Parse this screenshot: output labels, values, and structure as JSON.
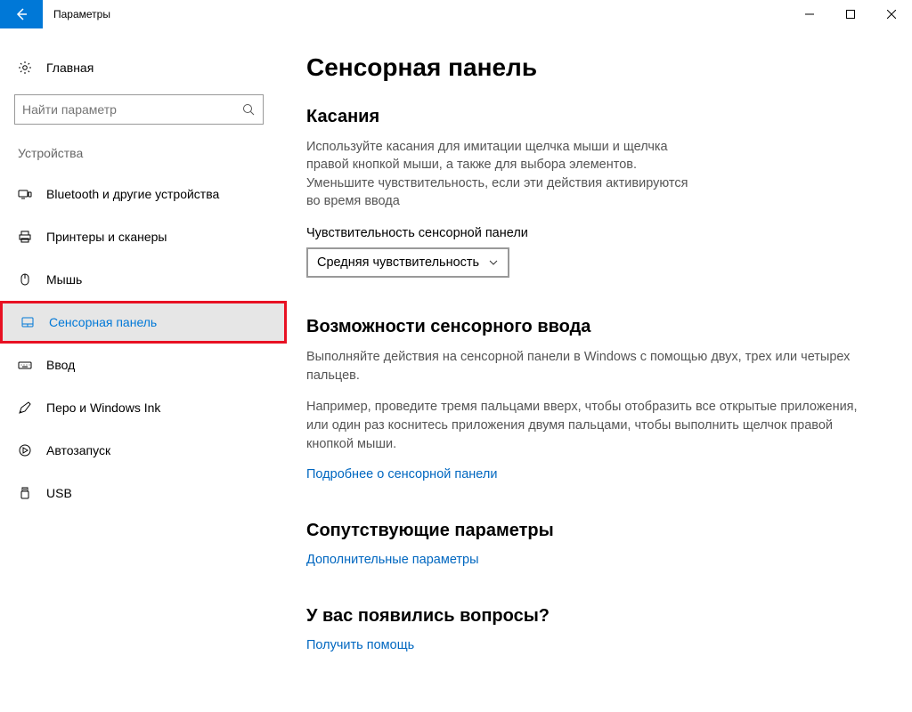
{
  "window": {
    "title": "Параметры"
  },
  "sidebar": {
    "home": "Главная",
    "search_placeholder": "Найти параметр",
    "category": "Устройства",
    "items": [
      {
        "label": "Bluetooth и другие устройства"
      },
      {
        "label": "Принтеры и сканеры"
      },
      {
        "label": "Мышь"
      },
      {
        "label": "Сенсорная панель"
      },
      {
        "label": "Ввод"
      },
      {
        "label": "Перо и Windows Ink"
      },
      {
        "label": "Автозапуск"
      },
      {
        "label": "USB"
      }
    ]
  },
  "main": {
    "title": "Сенсорная панель",
    "touch": {
      "heading": "Касания",
      "desc": "Используйте касания для имитации щелчка мыши и щелчка правой кнопкой мыши, а также для выбора элементов. Уменьшите чувствительность, если эти действия активируются во время ввода",
      "sensitivity_label": "Чувствительность сенсорной панели",
      "sensitivity_value": "Средняя чувствительность"
    },
    "gestures": {
      "heading": "Возможности сенсорного ввода",
      "p1": "Выполняйте действия на сенсорной панели в Windows с помощью двух, трех или четырех пальцев.",
      "p2": "Например, проведите тремя пальцами вверх, чтобы отобразить все открытые приложения, или один раз коснитесь приложения двумя пальцами, чтобы выполнить щелчок правой кнопкой мыши.",
      "link": "Подробнее о сенсорной панели"
    },
    "related": {
      "heading": "Сопутствующие параметры",
      "link": "Дополнительные параметры"
    },
    "help": {
      "heading": "У вас появились вопросы?",
      "link": "Получить помощь"
    }
  }
}
